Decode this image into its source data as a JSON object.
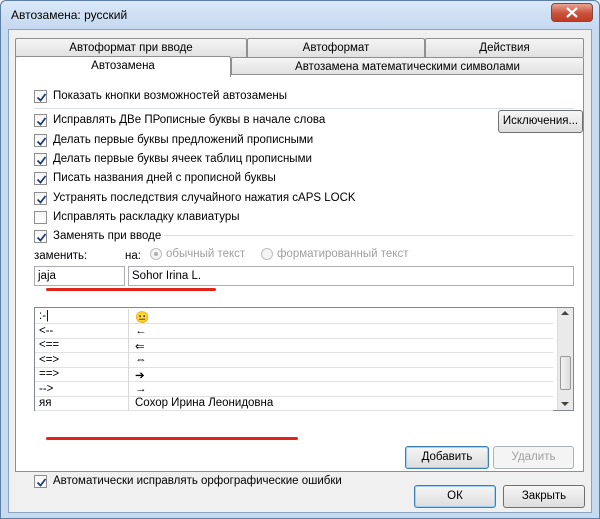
{
  "window": {
    "title": "Автозамена: русский"
  },
  "tabs": {
    "row1": [
      "Автоформат при вводе",
      "Автоформат",
      "Действия"
    ],
    "row2": [
      "Автозамена",
      "Автозамена математическими символами"
    ],
    "active": "Автозамена"
  },
  "options": {
    "show_buttons": "Показать кнопки возможностей автозамены",
    "two_initials": "Исправлять ДВе ПРописные буквы в начале слова",
    "cap_sentences": "Делать первые буквы предложений прописными",
    "cap_table_cells": "Делать первые буквы ячеек таблиц прописными",
    "cap_days": "Писать названия дней с прописной буквы",
    "caps_lock": "Устранять последствия случайного нажатия cAPS LOCK",
    "keyboard_layout": "Исправлять раскладку клавиатуры",
    "replace_as_type": "Заменять при вводе"
  },
  "checks": {
    "show_buttons": true,
    "two_initials": true,
    "cap_sentences": true,
    "cap_table_cells": true,
    "cap_days": true,
    "caps_lock": true,
    "keyboard_layout": false,
    "replace_as_type": true,
    "auto_spell": true
  },
  "exceptions_button": "Исключения...",
  "replace_section": {
    "replace_label": "заменить:",
    "with_label": "на:",
    "plain_text": "обычный текст",
    "formatted_text": "форматированный текст",
    "replace_value": "jaja",
    "with_value": "Sohor Irina L."
  },
  "list": {
    "rows": [
      {
        "from": ":-|",
        "to": "😐"
      },
      {
        "from": "<--",
        "to": "←"
      },
      {
        "from": "<==",
        "to": "⇐"
      },
      {
        "from": "<=>",
        "to": "⇔"
      },
      {
        "from": "==>",
        "to": "➔"
      },
      {
        "from": "-->",
        "to": "→"
      },
      {
        "from": "яя",
        "to": "Сохор Ирина Леонидовна"
      }
    ]
  },
  "add_button": "Добавить",
  "delete_button": "Удалить",
  "auto_spell_label": "Автоматически исправлять орфографические ошибки",
  "ok_button": "ОК",
  "close_button": "Закрыть",
  "colors": {
    "annotation": "#e2231a",
    "title_bar": "#c4d8ef",
    "close_button": "#c8513b"
  }
}
